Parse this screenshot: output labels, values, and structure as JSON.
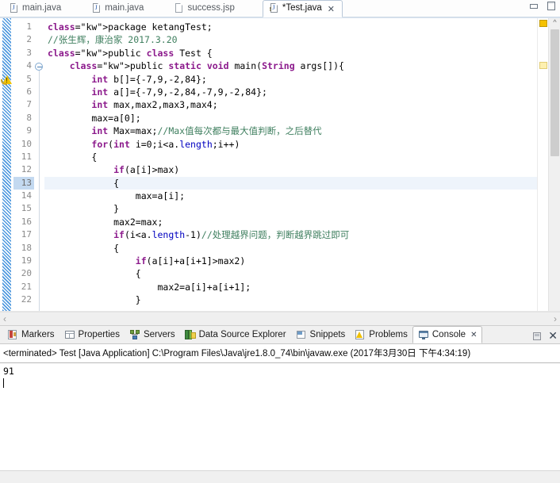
{
  "window": {
    "minimize_label": "Minimize",
    "maximize_label": "Maximize"
  },
  "editor_tabs": [
    {
      "label": "main.java",
      "icon": "java-file-icon",
      "active": false,
      "dirty": false,
      "warning": false
    },
    {
      "label": "main.java",
      "icon": "java-file-icon",
      "active": false,
      "dirty": false,
      "warning": false
    },
    {
      "label": "success.jsp",
      "icon": "jsp-file-icon",
      "active": false,
      "dirty": false,
      "warning": false
    },
    {
      "label": "*Test.java",
      "icon": "java-file-warning-icon",
      "active": true,
      "dirty": true,
      "warning": true
    }
  ],
  "editor_tab_close": "✕",
  "editor": {
    "current_line": 13,
    "first_line": 1,
    "last_line": 22,
    "lines": [
      {
        "n": 1,
        "text": "package ketangTest;"
      },
      {
        "n": 2,
        "text": "//张生辉，康治家 2017.3.20"
      },
      {
        "n": 3,
        "text": "public class Test {"
      },
      {
        "n": 4,
        "text": "    public static void main(String args[]){"
      },
      {
        "n": 5,
        "text": "        int b[]={-7,9,-2,84};"
      },
      {
        "n": 6,
        "text": "        int a[]={-7,9,-2,84,-7,9,-2,84};"
      },
      {
        "n": 7,
        "text": "        int max,max2,max3,max4;"
      },
      {
        "n": 8,
        "text": "        max=a[0];"
      },
      {
        "n": 9,
        "text": "        int Max=max;//Max值每次都与最大值判断，之后替代"
      },
      {
        "n": 10,
        "text": "        for(int i=0;i<a.length;i++)"
      },
      {
        "n": 11,
        "text": "        {"
      },
      {
        "n": 12,
        "text": "            if(a[i]>max)"
      },
      {
        "n": 13,
        "text": "            {"
      },
      {
        "n": 14,
        "text": "                max=a[i];"
      },
      {
        "n": 15,
        "text": "            }"
      },
      {
        "n": 16,
        "text": "            max2=max;"
      },
      {
        "n": 17,
        "text": "            if(i<a.length-1)//处理越界问题，判断越界跳过即可"
      },
      {
        "n": 18,
        "text": "            {"
      },
      {
        "n": 19,
        "text": "                if(a[i]+a[i+1]>max2)"
      },
      {
        "n": 20,
        "text": "                {"
      },
      {
        "n": 21,
        "text": "                    max2=a[i]+a[i+1];"
      },
      {
        "n": 22,
        "text": "                }"
      }
    ],
    "gutter": {
      "warning_line": 5,
      "fold_line": 4
    },
    "hscroll": {
      "left_arrow": "‹",
      "right_arrow": "›"
    },
    "vscroll": {
      "up_arrow": "^"
    }
  },
  "view_tabs": [
    {
      "label": "Markers",
      "icon": "markers-icon",
      "active": false,
      "closable": false
    },
    {
      "label": "Properties",
      "icon": "properties-icon",
      "active": false,
      "closable": false
    },
    {
      "label": "Servers",
      "icon": "servers-icon",
      "active": false,
      "closable": false
    },
    {
      "label": "Data Source Explorer",
      "icon": "data-source-explorer-icon",
      "active": false,
      "closable": false
    },
    {
      "label": "Snippets",
      "icon": "snippets-icon",
      "active": false,
      "closable": false
    },
    {
      "label": "Problems",
      "icon": "problems-icon",
      "active": false,
      "closable": false
    },
    {
      "label": "Console",
      "icon": "console-icon",
      "active": true,
      "closable": true
    }
  ],
  "view_tab_close": "✕",
  "panel_close": "✕",
  "console": {
    "header": "<terminated> Test [Java Application] C:\\Program Files\\Java\\jre1.8.0_74\\bin\\javaw.exe (2017年3月30日 下午4:34:19)",
    "output": "91"
  },
  "colors": {
    "keyword": "#8c1a8c",
    "comment": "#3f7f5f",
    "field": "#0000c0",
    "current_line_bg": "#eef4fb",
    "selected_line_number_bg": "#c3d9f0",
    "warning": "#f3c300",
    "scrollbar_thumb": "#cdcdcd"
  }
}
